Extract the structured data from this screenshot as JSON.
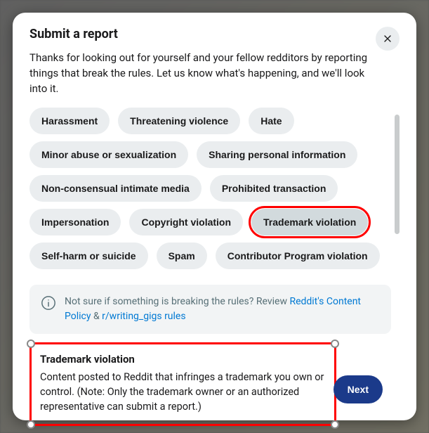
{
  "modal": {
    "title": "Submit a report",
    "intro": "Thanks for looking out for yourself and your fellow redditors by reporting things that break the rules. Let us know what's happening, and we'll look into it."
  },
  "report_options": [
    {
      "label": "Harassment",
      "selected": false
    },
    {
      "label": "Threatening violence",
      "selected": false
    },
    {
      "label": "Hate",
      "selected": false
    },
    {
      "label": "Minor abuse or sexualization",
      "selected": false
    },
    {
      "label": "Sharing personal information",
      "selected": false
    },
    {
      "label": "Non-consensual intimate media",
      "selected": false
    },
    {
      "label": "Prohibited transaction",
      "selected": false
    },
    {
      "label": "Impersonation",
      "selected": false
    },
    {
      "label": "Copyright violation",
      "selected": false
    },
    {
      "label": "Trademark violation",
      "selected": true
    },
    {
      "label": "Self-harm or suicide",
      "selected": false
    },
    {
      "label": "Spam",
      "selected": false
    },
    {
      "label": "Contributor Program violation",
      "selected": false
    }
  ],
  "info": {
    "prefix": "Not sure if something is breaking the rules? Review ",
    "policy_link": "Reddit's Content Policy",
    "middle": " & ",
    "rules_link": "r/writing_gigs rules"
  },
  "detail": {
    "title": "Trademark violation",
    "body": "Content posted to Reddit that infringes a trademark you own or control. (Note: Only the trademark owner or an authorized representative can submit a report.)"
  },
  "actions": {
    "next": "Next"
  }
}
